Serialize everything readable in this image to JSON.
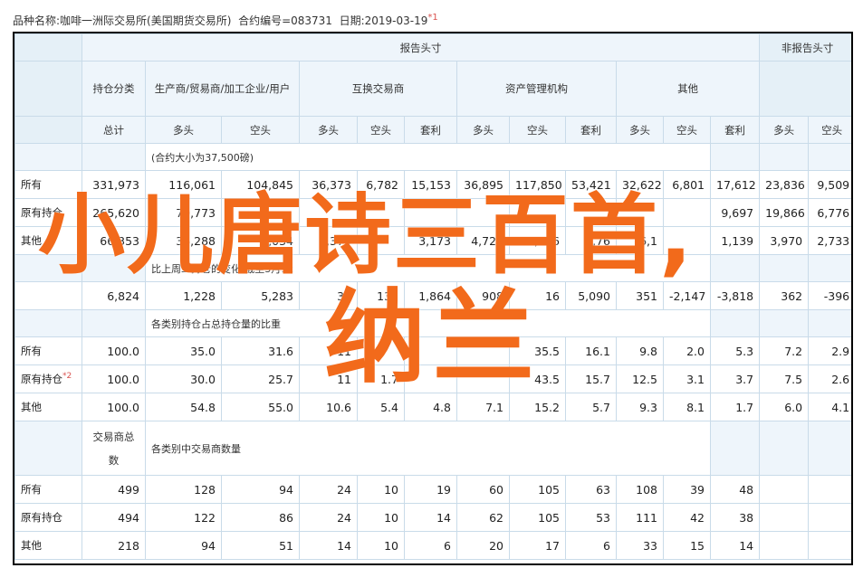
{
  "title": {
    "prefix": "品种名称:",
    "name": "咖啡一洲际交易所(美国期货交易所)",
    "code_label": "合约编号=",
    "code": "083731",
    "date_label": "日期:",
    "date": "2019-03-19",
    "note": "*1"
  },
  "header": {
    "reportable": "报告头寸",
    "nonreportable": "非报告头寸",
    "holding_category": "持仓分类",
    "total": "总计",
    "producer": "生产商/贸易商/加工企业/用户",
    "swap": "互换交易商",
    "managed": "资产管理机构",
    "other": "其他",
    "long": "多头",
    "short": "空头",
    "spread": "套利"
  },
  "sections": {
    "s1_caption": "(合约大小为37,500磅)",
    "s2_caption": "比上周二持仓的变化(截至3月12",
    "s3_caption": "各类别持仓占总持仓量的比重",
    "s4_cat_a": "交易商总",
    "s4_cat_b": "数",
    "s4_caption": "各类别中交易商数量"
  },
  "rows": {
    "all": "所有",
    "old": "原有持仓",
    "other": "其他",
    "old_note": "*2"
  },
  "positions": [
    [
      "所有",
      "331,973",
      "116,061",
      "104,845",
      "36,373",
      "6,782",
      "15,153",
      "36,895",
      "117,850",
      "53,421",
      "32,622",
      "6,801",
      "17,612",
      "23,836",
      "9,509"
    ],
    [
      "原有持仓",
      "265,620",
      "79,773",
      "",
      "",
      "",
      "",
      "",
      "",
      "",
      "",
      "",
      "",
      "19,866",
      "6,776"
    ],
    [
      "其他",
      "66,353",
      "36,288",
      "",
      "",
      "",
      "",
      "",
      "",
      "",
      "",
      "",
      "1,139",
      "3,970",
      "2,733"
    ]
  ],
  "positions_partial": {
    "r2": [
      "",
      "",
      "",
      "",
      "9,697"
    ],
    "r3_mid": [
      "1,034",
      "3,370",
      "3,173",
      "4,721",
      "10,676",
      "3,76",
      "6,1"
    ]
  },
  "change": [
    "6,824",
    "1,228",
    "5,283",
    "39",
    "132",
    "1,864",
    "908",
    "16",
    "5,090",
    "351",
    "-2,147",
    "-3,818",
    "362",
    "-396"
  ],
  "percent": [
    [
      "所有",
      "100.0",
      "35.0",
      "31.6",
      "11",
      "",
      "",
      "",
      "35.5",
      "16.1",
      "9.8",
      "2.0",
      "5.3",
      "7.2",
      "2.9"
    ],
    [
      "原有持仓",
      "100.0",
      "30.0",
      "25.7",
      "11",
      "1.7",
      "",
      "",
      "43.5",
      "15.7",
      "12.5",
      "3.1",
      "3.7",
      "7.5",
      "2.6"
    ],
    [
      "其他",
      "100.0",
      "54.8",
      "55.0",
      "10.6",
      "5.4",
      "4.8",
      "7.1",
      "15.2",
      "5.7",
      "9.3",
      "8.1",
      "1.7",
      "6.0",
      "4.1"
    ]
  ],
  "traders": [
    [
      "所有",
      "499",
      "128",
      "94",
      "24",
      "10",
      "19",
      "60",
      "105",
      "63",
      "108",
      "39",
      "48",
      "",
      ""
    ],
    [
      "原有持仓",
      "494",
      "122",
      "86",
      "24",
      "10",
      "14",
      "62",
      "105",
      "53",
      "111",
      "42",
      "38",
      "",
      ""
    ],
    [
      "其他",
      "218",
      "94",
      "51",
      "14",
      "10",
      "6",
      "20",
      "17",
      "6",
      "33",
      "15",
      "14",
      "",
      ""
    ]
  ],
  "overlay": {
    "line1": "小儿唐诗三百首,",
    "line2": "纳兰"
  },
  "colors": {
    "header_bg": "#eef5fb",
    "border": "#c9dbe9",
    "overlay": "#f26a1b",
    "note": "#d9534f"
  }
}
